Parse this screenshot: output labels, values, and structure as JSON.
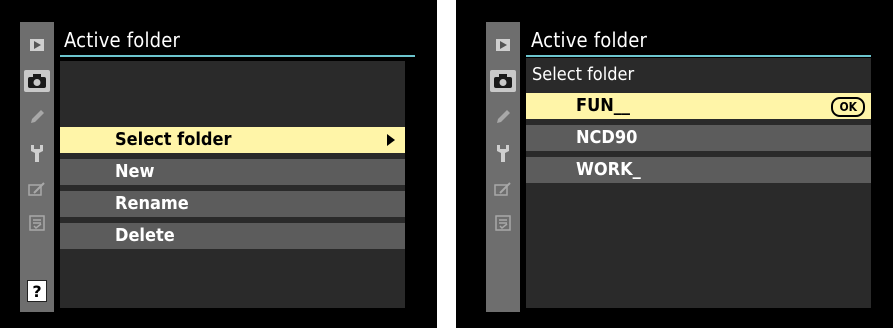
{
  "left_screen": {
    "title": "Active folder",
    "sidebar_icons": [
      "playback-icon",
      "camera-icon",
      "pencil-icon",
      "wrench-icon",
      "retouch-icon",
      "my-menu-icon",
      "help-icon"
    ],
    "help_label": "?",
    "menu_items": [
      {
        "label": "Select folder",
        "selected": true
      },
      {
        "label": "New",
        "selected": false
      },
      {
        "label": "Rename",
        "selected": false
      },
      {
        "label": "Delete",
        "selected": false
      }
    ]
  },
  "right_screen": {
    "title": "Active folder",
    "subtitle": "Select folder",
    "ok_label": "OK",
    "folders": [
      {
        "label": "FUN__",
        "selected": true
      },
      {
        "label": "NCD90",
        "selected": false
      },
      {
        "label": "WORK_",
        "selected": false
      }
    ]
  },
  "colors": {
    "highlight": "#fff5a8",
    "accent_line": "#6cc5ce",
    "row": "#5c5c5c",
    "sidebar": "#6e6e6e",
    "panel": "#2a2a2a"
  }
}
